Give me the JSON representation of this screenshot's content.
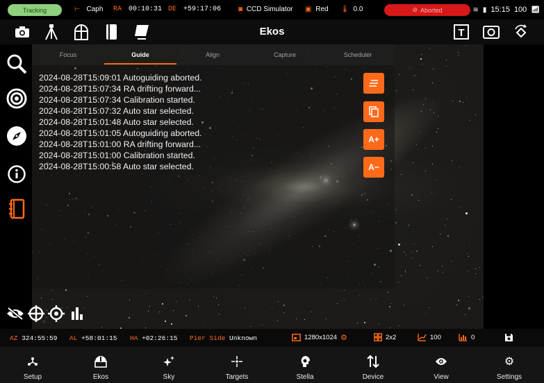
{
  "status": {
    "tracking": "Tracking",
    "target": "Caph",
    "ra_label": "RA",
    "ra_value": "00:10:31",
    "de_label": "DE",
    "de_value": "+59:17:06",
    "camera": "CCD Simulator",
    "filter": "Red",
    "temperature": "0.0",
    "guide_state": "Aborted",
    "battery": "100",
    "time": "15:15",
    "colors": {
      "accent": "#ff6a1a",
      "tracking_bg": "#8ed07e",
      "aborted_bg": "#d71818"
    }
  },
  "toolbar": {
    "title": "Ekos",
    "left_icons": [
      "camera-icon",
      "tripod-icon",
      "observatory-icon",
      "notebook-icon",
      "flat-panel-icon"
    ],
    "right_icons": [
      "text-overlay-icon",
      "screenshot-icon",
      "rotate-icon"
    ]
  },
  "sidenav": {
    "icons": [
      "search-icon",
      "target-icon",
      "compass-icon",
      "info-icon",
      "notebook-icon"
    ]
  },
  "tabs": [
    {
      "label": "Focus"
    },
    {
      "label": "Guide"
    },
    {
      "label": "Align"
    },
    {
      "label": "Capture"
    },
    {
      "label": "Scheduler"
    }
  ],
  "active_tab": "Guide",
  "log": [
    "2024-08-28T15:09:01 Autoguiding aborted.",
    "2024-08-28T15:07:34 RA drifting forward...",
    "2024-08-28T15:07:34 Calibration started.",
    "2024-08-28T15:07:32 Auto star selected.",
    "2024-08-28T15:01:48 Auto star selected.",
    "2024-08-28T15:01:05 Autoguiding aborted.",
    "2024-08-28T15:01:00 RA drifting forward...",
    "2024-08-28T15:01:00 Calibration started.",
    "2024-08-28T15:00:58 Auto star selected."
  ],
  "log_buttons": {
    "clear": "≡",
    "copy": "⧉",
    "font_up": "A+",
    "font_down": "A−"
  },
  "infobar": {
    "az_label": "AZ",
    "az_value": "324:55:59",
    "al_label": "AL",
    "al_value": "+58:01:15",
    "ha_label": "HA",
    "ha_value": "+02:26:15",
    "pier_label": "Pier Side",
    "pier_value": "Unknown",
    "resolution": "1280x1024",
    "binning": "2x2",
    "exposure": "100",
    "gain": "0"
  },
  "bottomnav": [
    {
      "label": "Setup",
      "icon": "network-icon"
    },
    {
      "label": "Ekos",
      "icon": "observatory-icon"
    },
    {
      "label": "Sky",
      "icon": "sparkle-icon"
    },
    {
      "label": "Targets",
      "icon": "crosshair-star-icon"
    },
    {
      "label": "Stella",
      "icon": "assistant-icon"
    },
    {
      "label": "Device",
      "icon": "arrows-updown-icon"
    },
    {
      "label": "View",
      "icon": "eye-icon"
    },
    {
      "label": "Settings",
      "icon": "gear-icon"
    }
  ]
}
